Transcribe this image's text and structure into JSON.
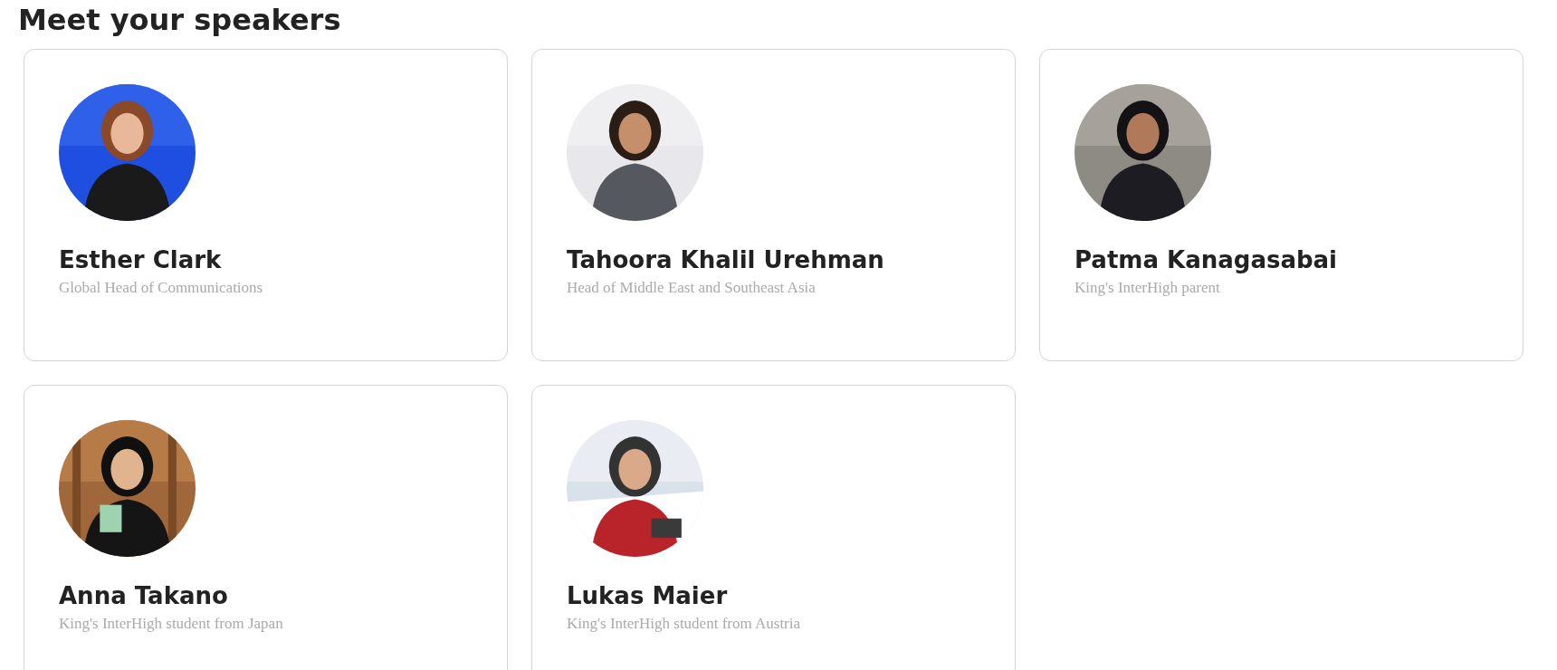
{
  "heading": "Meet your speakers",
  "speakers": [
    {
      "name": "Esther Clark",
      "role": "Global Head of Communications"
    },
    {
      "name": "Tahoora Khalil Urehman",
      "role": "Head of Middle East and Southeast Asia"
    },
    {
      "name": "Patma Kanagasabai",
      "role": "King's InterHigh parent"
    },
    {
      "name": "Anna Takano",
      "role": "King's InterHigh student from Japan"
    },
    {
      "name": "Lukas Maier",
      "role": "King's InterHigh student from Austria"
    }
  ]
}
